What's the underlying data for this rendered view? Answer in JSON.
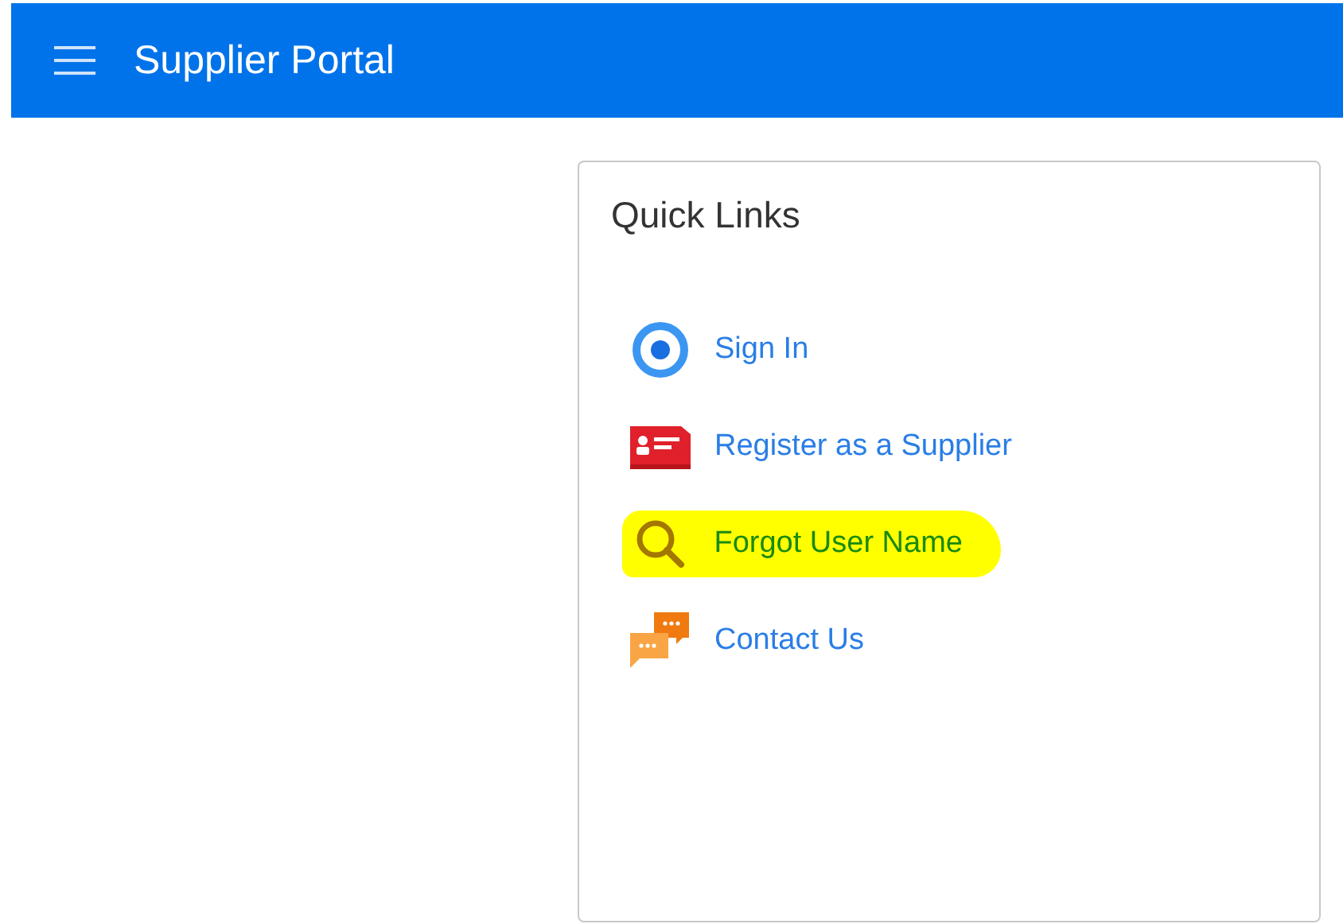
{
  "header": {
    "title": "Supplier Portal"
  },
  "quick_links": {
    "title": "Quick Links",
    "items": [
      {
        "kind": "signin",
        "label": "Sign In",
        "highlighted": false
      },
      {
        "kind": "register",
        "label": "Register as a Supplier",
        "highlighted": false
      },
      {
        "kind": "search",
        "label": "Forgot User Name",
        "highlighted": true
      },
      {
        "kind": "chat",
        "label": "Contact Us",
        "highlighted": false
      }
    ]
  }
}
